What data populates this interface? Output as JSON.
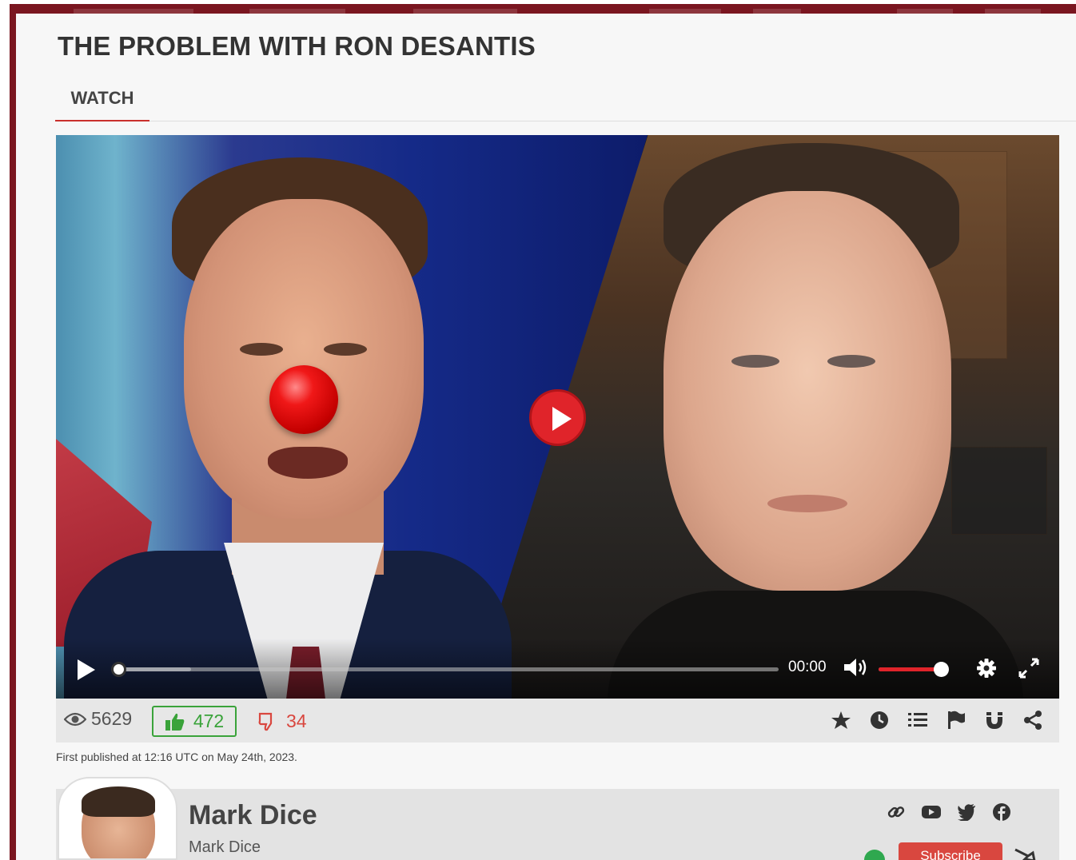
{
  "page": {
    "title": "THE PROBLEM WITH RON DESANTIS",
    "tabs": [
      {
        "label": "WATCH"
      }
    ]
  },
  "player": {
    "time": "00:00",
    "progress": 0,
    "buffered": 0.11,
    "volume": 0.9,
    "colors": {
      "accent": "#e0242a"
    }
  },
  "stats": {
    "views": "5629",
    "likes": "472",
    "dislikes": "34",
    "actions": [
      "star-icon",
      "clock-icon",
      "list-icon",
      "flag-icon",
      "magnet-icon",
      "share-icon"
    ]
  },
  "published": "First published at 12:16 UTC on May 24th, 2023.",
  "channel": {
    "name": "Mark Dice",
    "subtitle": "Mark Dice",
    "subscribe_label": "Subscribe",
    "socials": [
      "link-icon",
      "youtube-icon",
      "twitter-icon",
      "facebook-icon"
    ]
  },
  "colors": {
    "brand": "#7a1620",
    "like": "#3aa33a",
    "dislike": "#d9473f"
  }
}
